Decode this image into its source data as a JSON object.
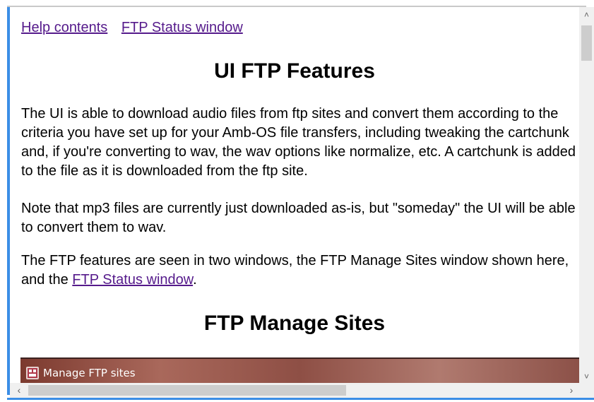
{
  "nav": {
    "help_contents": "Help contents",
    "ftp_status_window": "FTP Status window"
  },
  "page_title": "UI FTP Features",
  "paragraphs": {
    "p1": "The UI is able to download audio files from ftp sites and convert them according to the criteria you have set up for your Amb-OS file transfers, including tweaking the cartchunk and, if you're converting to wav, the wav options like normalize, etc. A cartchunk is added to the file as it is downloaded from the ftp site.",
    "p2": "Note that mp3 files are currently just downloaded as-is, but \"someday\" the UI will be able to convert them to wav.",
    "p3_before": "The FTP features are seen in two windows, the FTP Manage Sites window shown here, and the ",
    "p3_link": "FTP Status window",
    "p3_after": "."
  },
  "section_title": "FTP Manage Sites",
  "screenshot": {
    "window_title": "Manage FTP sites",
    "icon": "ftp-sites-icon"
  },
  "scrollbars": {
    "up_icon": "chevron-up-icon",
    "down_icon": "chevron-down-icon",
    "left_icon": "chevron-left-icon",
    "right_icon": "chevron-right-icon"
  },
  "colors": {
    "link": "#551a8b",
    "accent_border": "#3b8ee6"
  }
}
